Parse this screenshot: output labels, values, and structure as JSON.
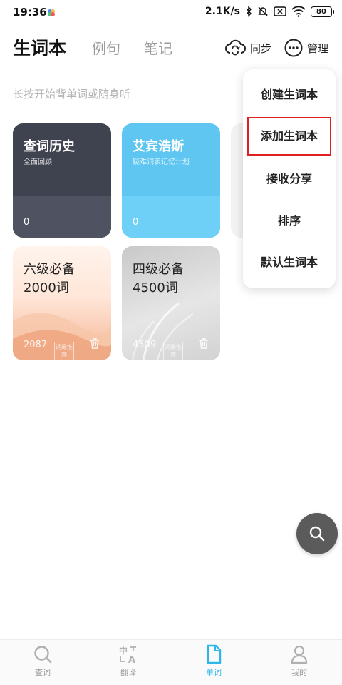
{
  "status_bar": {
    "time": "19:36",
    "network_speed": "2.1K/s",
    "battery": "80"
  },
  "header": {
    "tabs": [
      {
        "label": "生词本",
        "active": true
      },
      {
        "label": "例句",
        "active": false
      },
      {
        "label": "笔记",
        "active": false
      }
    ],
    "sync_label": "同步",
    "manage_label": "管理"
  },
  "hint": "长按开始背单词或随身听",
  "cards": [
    {
      "title": "查词历史",
      "subtitle": "全面回顾",
      "count": "0"
    },
    {
      "title": "艾宾浩斯",
      "subtitle": "疑难词表记忆计划",
      "count": "0"
    },
    {
      "title_line1": "六级必备",
      "title_line2": "2000词",
      "count": "2087",
      "stamp": "词霸推荐"
    },
    {
      "title_line1": "四级必备",
      "title_line2": "4500词",
      "count": "4509",
      "stamp": "词霸推荐"
    }
  ],
  "menu": {
    "items": [
      "创建生词本",
      "添加生词本",
      "接收分享",
      "排序",
      "默认生词本"
    ],
    "highlighted_index": 1
  },
  "bottom_nav": [
    {
      "label": "查词",
      "icon": "search-icon",
      "active": false
    },
    {
      "label": "翻译",
      "icon": "translate-icon",
      "active": false
    },
    {
      "label": "单词",
      "icon": "document-icon",
      "active": true
    },
    {
      "label": "我的",
      "icon": "person-icon",
      "active": false
    }
  ],
  "colors": {
    "accent": "#2fb6e9",
    "highlight_border": "#e02020",
    "card_dark": "#3f424f",
    "card_blue": "#5fc6f1"
  }
}
